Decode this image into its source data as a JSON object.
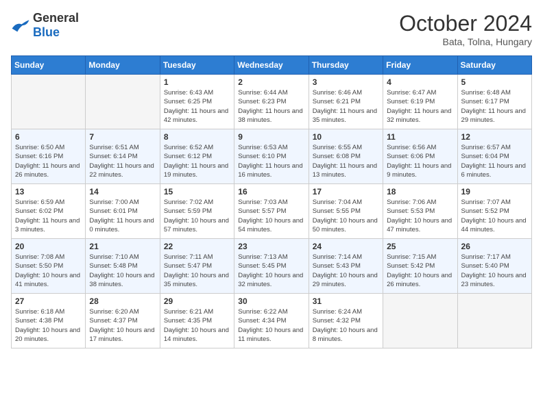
{
  "header": {
    "logo_general": "General",
    "logo_blue": "Blue",
    "month": "October 2024",
    "location": "Bata, Tolna, Hungary"
  },
  "days_of_week": [
    "Sunday",
    "Monday",
    "Tuesday",
    "Wednesday",
    "Thursday",
    "Friday",
    "Saturday"
  ],
  "weeks": [
    [
      {
        "day": "",
        "info": ""
      },
      {
        "day": "",
        "info": ""
      },
      {
        "day": "1",
        "info": "Sunrise: 6:43 AM\nSunset: 6:25 PM\nDaylight: 11 hours and 42 minutes."
      },
      {
        "day": "2",
        "info": "Sunrise: 6:44 AM\nSunset: 6:23 PM\nDaylight: 11 hours and 38 minutes."
      },
      {
        "day": "3",
        "info": "Sunrise: 6:46 AM\nSunset: 6:21 PM\nDaylight: 11 hours and 35 minutes."
      },
      {
        "day": "4",
        "info": "Sunrise: 6:47 AM\nSunset: 6:19 PM\nDaylight: 11 hours and 32 minutes."
      },
      {
        "day": "5",
        "info": "Sunrise: 6:48 AM\nSunset: 6:17 PM\nDaylight: 11 hours and 29 minutes."
      }
    ],
    [
      {
        "day": "6",
        "info": "Sunrise: 6:50 AM\nSunset: 6:16 PM\nDaylight: 11 hours and 26 minutes."
      },
      {
        "day": "7",
        "info": "Sunrise: 6:51 AM\nSunset: 6:14 PM\nDaylight: 11 hours and 22 minutes."
      },
      {
        "day": "8",
        "info": "Sunrise: 6:52 AM\nSunset: 6:12 PM\nDaylight: 11 hours and 19 minutes."
      },
      {
        "day": "9",
        "info": "Sunrise: 6:53 AM\nSunset: 6:10 PM\nDaylight: 11 hours and 16 minutes."
      },
      {
        "day": "10",
        "info": "Sunrise: 6:55 AM\nSunset: 6:08 PM\nDaylight: 11 hours and 13 minutes."
      },
      {
        "day": "11",
        "info": "Sunrise: 6:56 AM\nSunset: 6:06 PM\nDaylight: 11 hours and 9 minutes."
      },
      {
        "day": "12",
        "info": "Sunrise: 6:57 AM\nSunset: 6:04 PM\nDaylight: 11 hours and 6 minutes."
      }
    ],
    [
      {
        "day": "13",
        "info": "Sunrise: 6:59 AM\nSunset: 6:02 PM\nDaylight: 11 hours and 3 minutes."
      },
      {
        "day": "14",
        "info": "Sunrise: 7:00 AM\nSunset: 6:01 PM\nDaylight: 11 hours and 0 minutes."
      },
      {
        "day": "15",
        "info": "Sunrise: 7:02 AM\nSunset: 5:59 PM\nDaylight: 10 hours and 57 minutes."
      },
      {
        "day": "16",
        "info": "Sunrise: 7:03 AM\nSunset: 5:57 PM\nDaylight: 10 hours and 54 minutes."
      },
      {
        "day": "17",
        "info": "Sunrise: 7:04 AM\nSunset: 5:55 PM\nDaylight: 10 hours and 50 minutes."
      },
      {
        "day": "18",
        "info": "Sunrise: 7:06 AM\nSunset: 5:53 PM\nDaylight: 10 hours and 47 minutes."
      },
      {
        "day": "19",
        "info": "Sunrise: 7:07 AM\nSunset: 5:52 PM\nDaylight: 10 hours and 44 minutes."
      }
    ],
    [
      {
        "day": "20",
        "info": "Sunrise: 7:08 AM\nSunset: 5:50 PM\nDaylight: 10 hours and 41 minutes."
      },
      {
        "day": "21",
        "info": "Sunrise: 7:10 AM\nSunset: 5:48 PM\nDaylight: 10 hours and 38 minutes."
      },
      {
        "day": "22",
        "info": "Sunrise: 7:11 AM\nSunset: 5:47 PM\nDaylight: 10 hours and 35 minutes."
      },
      {
        "day": "23",
        "info": "Sunrise: 7:13 AM\nSunset: 5:45 PM\nDaylight: 10 hours and 32 minutes."
      },
      {
        "day": "24",
        "info": "Sunrise: 7:14 AM\nSunset: 5:43 PM\nDaylight: 10 hours and 29 minutes."
      },
      {
        "day": "25",
        "info": "Sunrise: 7:15 AM\nSunset: 5:42 PM\nDaylight: 10 hours and 26 minutes."
      },
      {
        "day": "26",
        "info": "Sunrise: 7:17 AM\nSunset: 5:40 PM\nDaylight: 10 hours and 23 minutes."
      }
    ],
    [
      {
        "day": "27",
        "info": "Sunrise: 6:18 AM\nSunset: 4:38 PM\nDaylight: 10 hours and 20 minutes."
      },
      {
        "day": "28",
        "info": "Sunrise: 6:20 AM\nSunset: 4:37 PM\nDaylight: 10 hours and 17 minutes."
      },
      {
        "day": "29",
        "info": "Sunrise: 6:21 AM\nSunset: 4:35 PM\nDaylight: 10 hours and 14 minutes."
      },
      {
        "day": "30",
        "info": "Sunrise: 6:22 AM\nSunset: 4:34 PM\nDaylight: 10 hours and 11 minutes."
      },
      {
        "day": "31",
        "info": "Sunrise: 6:24 AM\nSunset: 4:32 PM\nDaylight: 10 hours and 8 minutes."
      },
      {
        "day": "",
        "info": ""
      },
      {
        "day": "",
        "info": ""
      }
    ]
  ]
}
